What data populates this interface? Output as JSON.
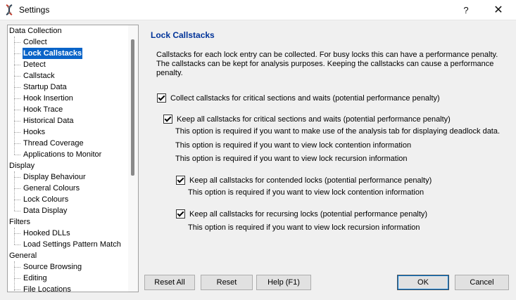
{
  "window": {
    "title": "Settings",
    "help_glyph": "?",
    "close_glyph": "✕"
  },
  "tree": {
    "items": [
      {
        "label": "Data Collection",
        "level": 0
      },
      {
        "label": "Collect",
        "level": 1
      },
      {
        "label": "Lock Callstacks",
        "level": 1,
        "selected": true
      },
      {
        "label": "Detect",
        "level": 1
      },
      {
        "label": "Callstack",
        "level": 1
      },
      {
        "label": "Startup Data",
        "level": 1
      },
      {
        "label": "Hook Insertion",
        "level": 1
      },
      {
        "label": "Hook Trace",
        "level": 1
      },
      {
        "label": "Historical Data",
        "level": 1
      },
      {
        "label": "Hooks",
        "level": 1
      },
      {
        "label": "Thread Coverage",
        "level": 1
      },
      {
        "label": "Applications to Monitor",
        "level": 1
      },
      {
        "label": "Display",
        "level": 0
      },
      {
        "label": "Display Behaviour",
        "level": 1
      },
      {
        "label": "General Colours",
        "level": 1
      },
      {
        "label": "Lock Colours",
        "level": 1
      },
      {
        "label": "Data Display",
        "level": 1
      },
      {
        "label": "Filters",
        "level": 0
      },
      {
        "label": "Hooked DLLs",
        "level": 1
      },
      {
        "label": "Load Settings Pattern Match",
        "level": 1
      },
      {
        "label": "General",
        "level": 0
      },
      {
        "label": "Source Browsing",
        "level": 1
      },
      {
        "label": "Editing",
        "level": 1
      },
      {
        "label": "File Locations",
        "level": 1
      }
    ]
  },
  "panel": {
    "title": "Lock Callstacks",
    "description": "Callstacks for each lock entry can be collected. For busy locks this can have a performance penalty. The callstacks can be kept for analysis purposes. Keeping the callstacks can cause a performance penalty.",
    "opt_collect": "Collect callstacks for critical sections and waits (potential performance penalty)",
    "opt_keep_all": "Keep all callstacks for critical sections and waits (potential performance penalty)",
    "note_deadlock": "This option is required if you want to make use of the analysis tab for displaying deadlock data.",
    "note_contention_1": "This option is required if you want to view lock contention information",
    "note_recursion_1": "This option is required if you want to view lock recursion information",
    "opt_contended": "Keep all callstacks for contended locks (potential performance penalty)",
    "note_contention_2": "This option is required if you want to view lock contention information",
    "opt_recursing": "Keep all callstacks for recursing locks (potential performance penalty)",
    "note_recursion_2": "This option is required if you want to view lock recursion information",
    "checked": {
      "collect": true,
      "keep_all": true,
      "contended": true,
      "recursing": true
    }
  },
  "buttons": {
    "reset_all": "Reset All",
    "reset": "Reset",
    "help": "Help (F1)",
    "ok": "OK",
    "cancel": "Cancel"
  },
  "colors": {
    "selection": "#0a64c8",
    "section_title": "#003399"
  }
}
